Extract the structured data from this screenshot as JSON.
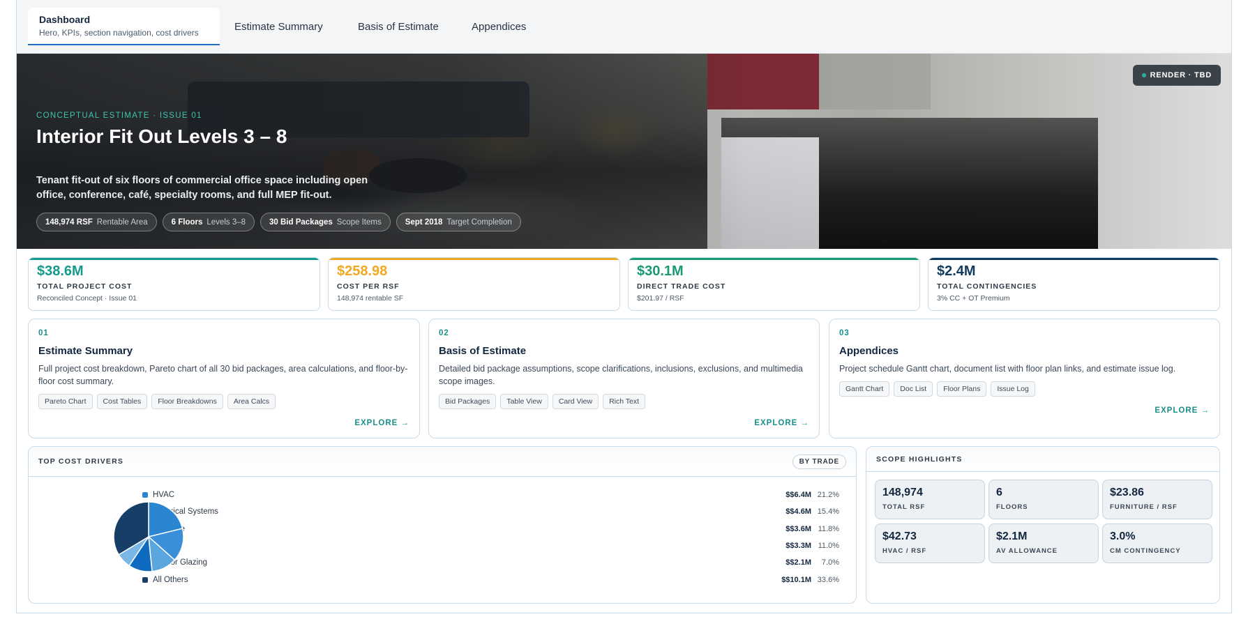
{
  "tabs": [
    {
      "label": "Dashboard",
      "sub": "Hero, KPIs, section navigation, cost drivers"
    },
    {
      "label": "Estimate Summary"
    },
    {
      "label": "Basis of Estimate"
    },
    {
      "label": "Appendices"
    }
  ],
  "hero": {
    "badge": "RENDER · TBD",
    "kicker": "CONCEPTUAL ESTIMATE · ISSUE 01",
    "title": "Interior Fit Out Levels 3 – 8",
    "description": "Tenant fit-out of six floors of commercial office space including open office, conference, café, specialty rooms, and full MEP fit-out.",
    "pills": [
      {
        "value": "148,974 RSF",
        "label": "Rentable Area"
      },
      {
        "value": "6 Floors",
        "label": "Levels 3–8"
      },
      {
        "value": "30 Bid Packages",
        "label": "Scope Items"
      },
      {
        "value": "Sept 2018",
        "label": "Target Completion"
      }
    ]
  },
  "kpis": [
    {
      "value": "$38.6M",
      "label": "TOTAL PROJECT COST",
      "sub": "Reconciled Concept · Issue 01",
      "color": "#159a8c"
    },
    {
      "value": "$258.98",
      "label": "COST PER RSF",
      "sub": "148,974 rentable SF",
      "color": "#f2a922"
    },
    {
      "value": "$30.1M",
      "label": "DIRECT TRADE COST",
      "sub": "$201.97 / RSF",
      "color": "#1a9a74"
    },
    {
      "value": "$2.4M",
      "label": "TOTAL CONTINGENCIES",
      "sub": "3% CC + OT Premium",
      "color": "#123a5e"
    }
  ],
  "sections": [
    {
      "num": "01",
      "title": "Estimate Summary",
      "desc": "Full project cost breakdown, Pareto chart of all 30 bid packages, area calculations, and floor-by-floor cost summary.",
      "tags": [
        "Pareto Chart",
        "Cost Tables",
        "Floor Breakdowns",
        "Area Calcs"
      ],
      "explore": "EXPLORE →"
    },
    {
      "num": "02",
      "title": "Basis of Estimate",
      "desc": "Detailed bid package assumptions, scope clarifications, inclusions, exclusions, and multimedia scope images.",
      "tags": [
        "Bid Packages",
        "Table View",
        "Card View",
        "Rich Text"
      ],
      "explore": "EXPLORE →"
    },
    {
      "num": "03",
      "title": "Appendices",
      "desc": "Project schedule Gantt chart, document list with floor plan links, and estimate issue log.",
      "tags": [
        "Gantt Chart",
        "Doc List",
        "Floor Plans",
        "Issue Log"
      ],
      "explore": "EXPLORE →"
    }
  ],
  "cost_drivers": {
    "title": "TOP COST DRIVERS",
    "toggle": "BY TRADE",
    "items": [
      {
        "name": "HVAC",
        "amount": "$$6.4M",
        "pct": "21.2%",
        "color": "#2b86d1"
      },
      {
        "name": "Electrical Systems",
        "amount": "$$4.6M",
        "pct": "15.4%",
        "color": "#3a8fd8"
      },
      {
        "name": "Furniture",
        "amount": "$$3.6M",
        "pct": "11.8%",
        "color": "#5aa6df"
      },
      {
        "name": "Drywall",
        "amount": "$$3.3M",
        "pct": "11.0%",
        "color": "#0f6bbf"
      },
      {
        "name": "Interior Glazing",
        "amount": "$$2.1M",
        "pct": "7.0%",
        "color": "#7ab7e6"
      },
      {
        "name": "All Others",
        "amount": "$$10.1M",
        "pct": "33.6%",
        "color": "#173e66"
      }
    ]
  },
  "chart_data": {
    "type": "pie",
    "categories": [
      "HVAC",
      "Electrical Systems",
      "Furniture",
      "Drywall",
      "Interior Glazing",
      "All Others"
    ],
    "values": [
      21.2,
      15.4,
      11.8,
      11.0,
      7.0,
      33.6
    ],
    "amounts": [
      "$$6.4M",
      "$$4.6M",
      "$$3.6M",
      "$$3.3M",
      "$$2.1M",
      "$$10.1M"
    ]
  },
  "scope": {
    "title": "SCOPE HIGHLIGHTS",
    "stats": [
      {
        "value": "148,974",
        "label": "TOTAL RSF"
      },
      {
        "value": "6",
        "label": "FLOORS"
      },
      {
        "value": "$23.86",
        "label": "FURNITURE / RSF"
      },
      {
        "value": "$42.73",
        "label": "HVAC / RSF"
      },
      {
        "value": "$2.1M",
        "label": "AV ALLOWANCE"
      },
      {
        "value": "3.0%",
        "label": "CM CONTINGENCY"
      }
    ]
  }
}
